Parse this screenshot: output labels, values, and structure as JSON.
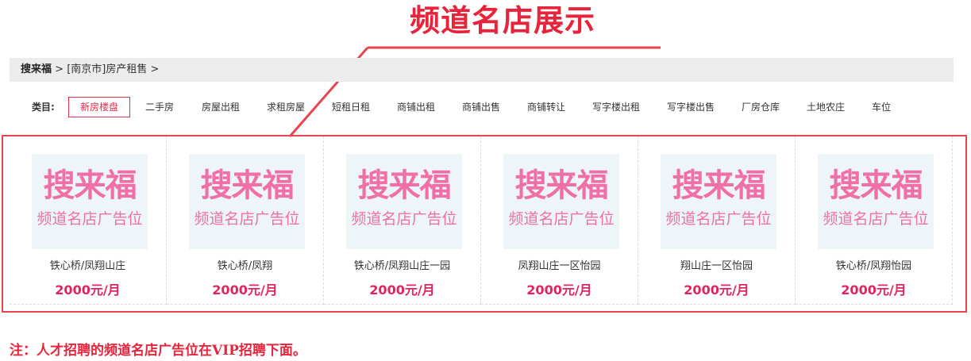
{
  "page": {
    "heading": "频道名店展示",
    "accent_color": "#e8243c",
    "price_color": "#e0245e",
    "ad_text_color": "#f06fa6"
  },
  "breadcrumb": {
    "home": "搜来福",
    "sep1": " > ",
    "section": "[南京市]房产租售",
    "sep2": " >"
  },
  "categories": {
    "label": "类目:",
    "items": [
      "新房楼盘",
      "二手房",
      "房屋出租",
      "求租房屋",
      "短租日租",
      "商铺出租",
      "商铺出售",
      "商铺转让",
      "写字楼出租",
      "写字楼出售",
      "厂房仓库",
      "土地农庄",
      "车位"
    ],
    "active_index": 0
  },
  "shops": [
    {
      "ad_logo": "搜来福",
      "ad_slot": "频道名店广告位",
      "name": "铁心桥/凤翔山庄",
      "price": "2000元/月"
    },
    {
      "ad_logo": "搜来福",
      "ad_slot": "频道名店广告位",
      "name": "铁心桥/凤翔",
      "price": "2000元/月"
    },
    {
      "ad_logo": "搜来福",
      "ad_slot": "频道名店广告位",
      "name": "铁心桥/凤翔山庄一园",
      "price": "2000元/月"
    },
    {
      "ad_logo": "搜来福",
      "ad_slot": "频道名店广告位",
      "name": "凤翔山庄一区怡园",
      "price": "2000元/月"
    },
    {
      "ad_logo": "搜来福",
      "ad_slot": "频道名店广告位",
      "name": "翔山庄一区怡园",
      "price": "2000元/月"
    },
    {
      "ad_logo": "搜来福",
      "ad_slot": "频道名店广告位",
      "name": "铁心桥/凤翔怡园",
      "price": "2000元/月"
    }
  ],
  "note": "注：人才招聘的频道名店广告位在VIP招聘下面。"
}
